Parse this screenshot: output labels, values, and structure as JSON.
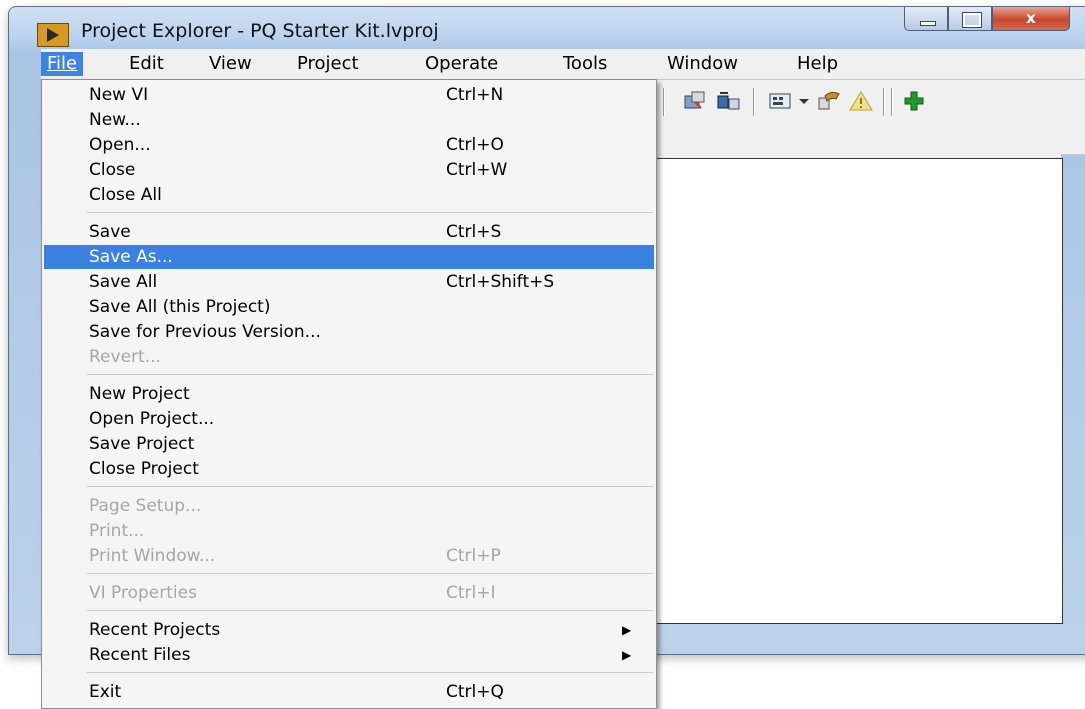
{
  "window": {
    "title": "Project Explorer - PQ Starter Kit.lvproj",
    "close_glyph": "x"
  },
  "menubar": {
    "items": [
      "File",
      "Edit",
      "View",
      "Project",
      "Operate",
      "Tools",
      "Window",
      "Help"
    ],
    "active": "File"
  },
  "toolbar": {
    "icons": [
      "build-spec-icon",
      "deploy-icon",
      "view-icon",
      "dropdown-arrow-icon",
      "properties-icon",
      "warning-icon",
      "add-icon"
    ]
  },
  "file_menu": {
    "items": [
      {
        "label": "New VI",
        "shortcut": "Ctrl+N"
      },
      {
        "label": "New...",
        "shortcut": ""
      },
      {
        "label": "Open...",
        "shortcut": "Ctrl+O"
      },
      {
        "label": "Close",
        "shortcut": "Ctrl+W"
      },
      {
        "label": "Close All",
        "shortcut": ""
      },
      {
        "label": "Save",
        "shortcut": "Ctrl+S"
      },
      {
        "label": "Save As...",
        "shortcut": ""
      },
      {
        "label": "Save All",
        "shortcut": "Ctrl+Shift+S"
      },
      {
        "label": "Save All (this Project)",
        "shortcut": ""
      },
      {
        "label": "Save for Previous Version...",
        "shortcut": ""
      },
      {
        "label": "Revert...",
        "shortcut": ""
      },
      {
        "label": "New Project",
        "shortcut": ""
      },
      {
        "label": "Open Project...",
        "shortcut": ""
      },
      {
        "label": "Save Project",
        "shortcut": ""
      },
      {
        "label": "Close Project",
        "shortcut": ""
      },
      {
        "label": "Page Setup...",
        "shortcut": ""
      },
      {
        "label": "Print...",
        "shortcut": ""
      },
      {
        "label": "Print Window...",
        "shortcut": "Ctrl+P"
      },
      {
        "label": "VI Properties",
        "shortcut": "Ctrl+I"
      },
      {
        "label": "Recent Projects",
        "shortcut": ""
      },
      {
        "label": "Recent Files",
        "shortcut": ""
      },
      {
        "label": "Exit",
        "shortcut": "Ctrl+Q"
      }
    ],
    "highlighted": "Save As...",
    "disabled": [
      "Revert...",
      "Page Setup...",
      "Print...",
      "Print Window...",
      "VI Properties"
    ],
    "submenus": [
      "Recent Projects",
      "Recent Files"
    ]
  },
  "colors": {
    "highlight": "#3b82e0",
    "disabled_text": "#a6a6a6"
  }
}
